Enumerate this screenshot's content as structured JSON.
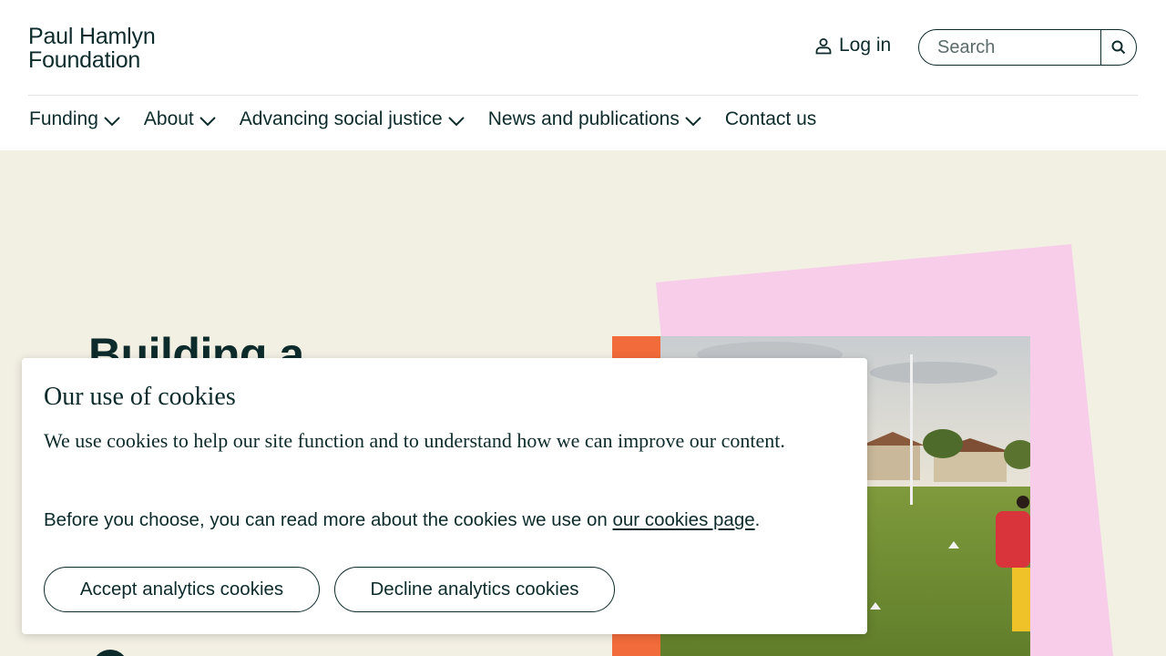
{
  "header": {
    "logo_line1": "Paul Hamlyn",
    "logo_line2": "Foundation",
    "login_label": "Log in",
    "search_placeholder": "Search"
  },
  "nav": {
    "items": [
      {
        "label": "Funding",
        "has_dropdown": true
      },
      {
        "label": "About",
        "has_dropdown": true
      },
      {
        "label": "Advancing social justice",
        "has_dropdown": true
      },
      {
        "label": "News and publications",
        "has_dropdown": true
      },
      {
        "label": "Contact us",
        "has_dropdown": false
      }
    ]
  },
  "hero": {
    "title": "Building a"
  },
  "cookie_banner": {
    "title": "Our use of cookies",
    "paragraph1": "We use cookies to help our site function and to understand how we can improve our content.",
    "paragraph2_prefix": "Before you choose, you can read more about the cookies we use on ",
    "paragraph2_link": "our cookies page",
    "paragraph2_suffix": ".",
    "accept_label": "Accept analytics cookies",
    "decline_label": "Decline analytics cookies"
  },
  "colors": {
    "text": "#0d2b2b",
    "hero_bg": "#f2efe3",
    "pink_accent": "#f7cdea",
    "orange_accent": "#f26b3a"
  }
}
